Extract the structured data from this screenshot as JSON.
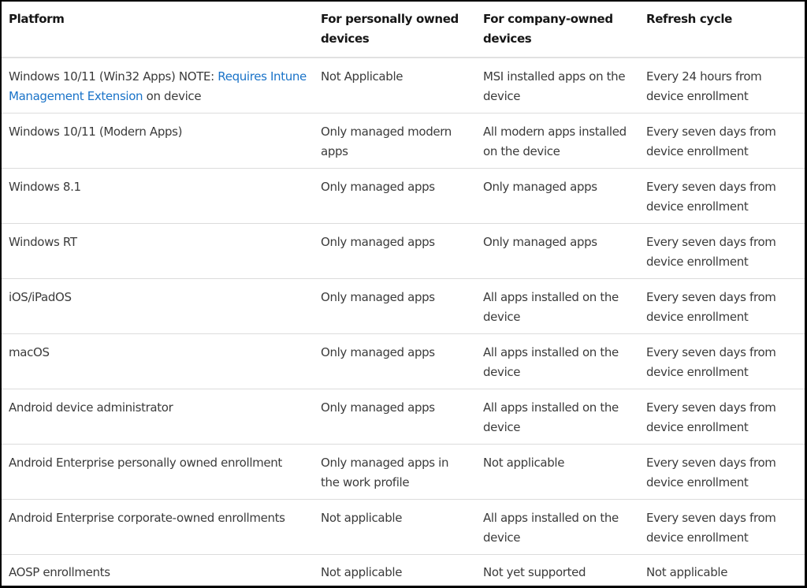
{
  "colors": {
    "link": "#1a73c8",
    "text": "#3b3b3b",
    "header_text": "#161616",
    "row_divider": "#dcdcdc",
    "frame_border": "#000000"
  },
  "table": {
    "headers": [
      "Platform",
      "For personally owned devices",
      "For company-owned devices",
      "Refresh cycle"
    ],
    "rows": [
      {
        "platform": "Windows 10/11 (Win32 Apps) NOTE: ",
        "platform_link": "Requires Intune Management Extension",
        "platform_suffix": " on device",
        "personal": "Not Applicable",
        "company": "MSI installed apps on the device",
        "refresh": "Every 24 hours from device enrollment"
      },
      {
        "platform": "Windows 10/11 (Modern Apps)",
        "personal": "Only managed modern apps",
        "company": "All modern apps installed on the device",
        "refresh": "Every seven days from device enrollment"
      },
      {
        "platform": "Windows 8.1",
        "personal": "Only managed apps",
        "company": "Only managed apps",
        "refresh": "Every seven days from device enrollment"
      },
      {
        "platform": "Windows RT",
        "personal": "Only managed apps",
        "company": "Only managed apps",
        "refresh": "Every seven days from device enrollment"
      },
      {
        "platform": "iOS/iPadOS",
        "personal": "Only managed apps",
        "company": "All apps installed on the device",
        "refresh": "Every seven days from device enrollment"
      },
      {
        "platform": "macOS",
        "personal": "Only managed apps",
        "company": "All apps installed on the device",
        "refresh": "Every seven days from device enrollment"
      },
      {
        "platform": "Android device administrator",
        "personal": "Only managed apps",
        "company": "All apps installed on the device",
        "refresh": "Every seven days from device enrollment"
      },
      {
        "platform": "Android Enterprise personally owned enrollment",
        "personal": "Only managed apps in the work profile",
        "company": "Not applicable",
        "refresh": "Every seven days from device enrollment"
      },
      {
        "platform": "Android Enterprise corporate-owned enrollments",
        "personal": "Not applicable",
        "company": "All apps installed on the device",
        "refresh": "Every seven days from device enrollment"
      },
      {
        "platform": "AOSP enrollments",
        "personal": "Not applicable",
        "company": "Not yet supported",
        "refresh": "Not applicable"
      }
    ]
  }
}
